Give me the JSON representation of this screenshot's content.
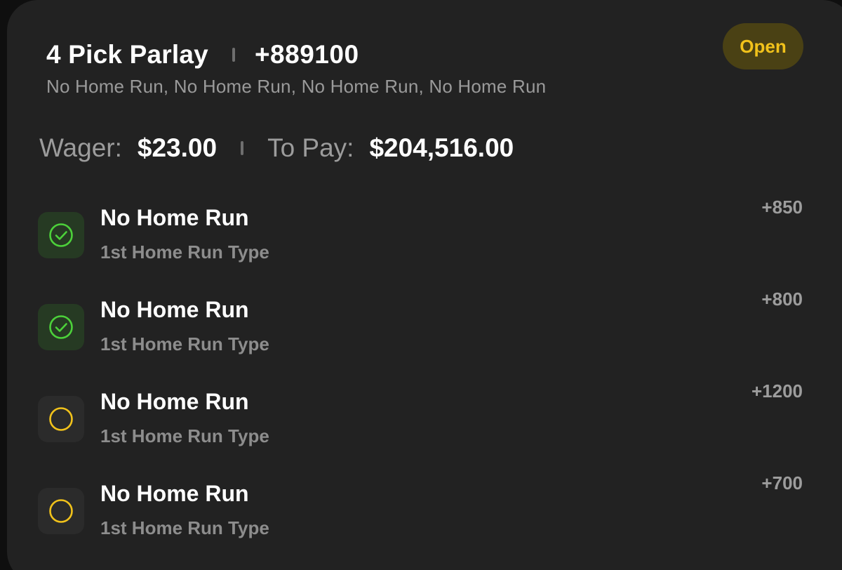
{
  "bet": {
    "title": "4 Pick Parlay",
    "total_odds": "+889100",
    "subtitle": "No Home Run, No Home Run, No Home Run, No Home Run",
    "status": "Open",
    "wager_label": "Wager:",
    "wager_value": "$23.00",
    "to_pay_label": "To Pay:",
    "to_pay_value": "$204,516.00"
  },
  "legs": [
    {
      "name": "No Home Run",
      "market": "1st Home Run Type",
      "odds": "+850",
      "status": "won",
      "icon": "check-circle-icon"
    },
    {
      "name": "No Home Run",
      "market": "1st Home Run Type",
      "odds": "+800",
      "status": "won",
      "icon": "check-circle-icon"
    },
    {
      "name": "No Home Run",
      "market": "1st Home Run Type",
      "odds": "+1200",
      "status": "pending",
      "icon": "empty-circle-icon"
    },
    {
      "name": "No Home Run",
      "market": "1st Home Run Type",
      "odds": "+700",
      "status": "pending",
      "icon": "empty-circle-icon"
    }
  ],
  "colors": {
    "background": "#222222",
    "won": "#4cd13a",
    "pending": "#f1c21b",
    "badge_bg": "#4a4114"
  }
}
